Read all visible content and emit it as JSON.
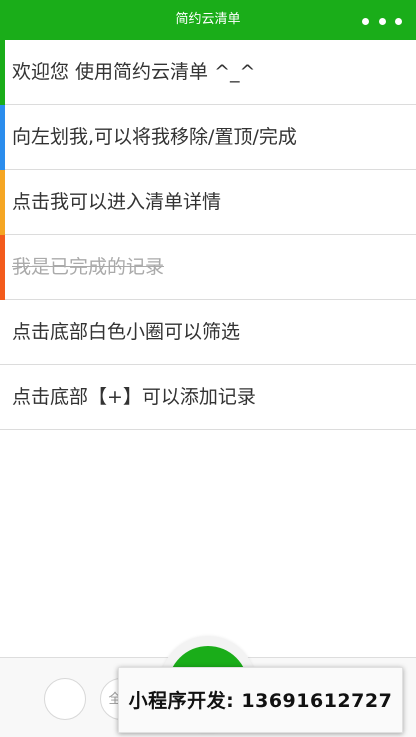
{
  "header": {
    "title": "简约云清单"
  },
  "items": [
    {
      "text": "欢迎您  使用简约云清单 ^_^",
      "color": "#1aad19",
      "done": false
    },
    {
      "text": "向左划我,可以将我移除/置顶/完成",
      "color": "#2b8ded",
      "done": false
    },
    {
      "text": "点击我可以进入清单详情",
      "color": "#f5a623",
      "done": false
    },
    {
      "text": "我是已完成的记录",
      "color": "#f35b1c",
      "done": true
    },
    {
      "text": "点击底部白色小圈可以筛选",
      "color": "",
      "done": false
    },
    {
      "text": "点击底部【+】可以添加记录",
      "color": "",
      "done": false
    }
  ],
  "bottom": {
    "filter_all_label": "全"
  },
  "promo": {
    "text": "小程序开发: 13691612727"
  },
  "colors": {
    "brand": "#1aad19"
  }
}
